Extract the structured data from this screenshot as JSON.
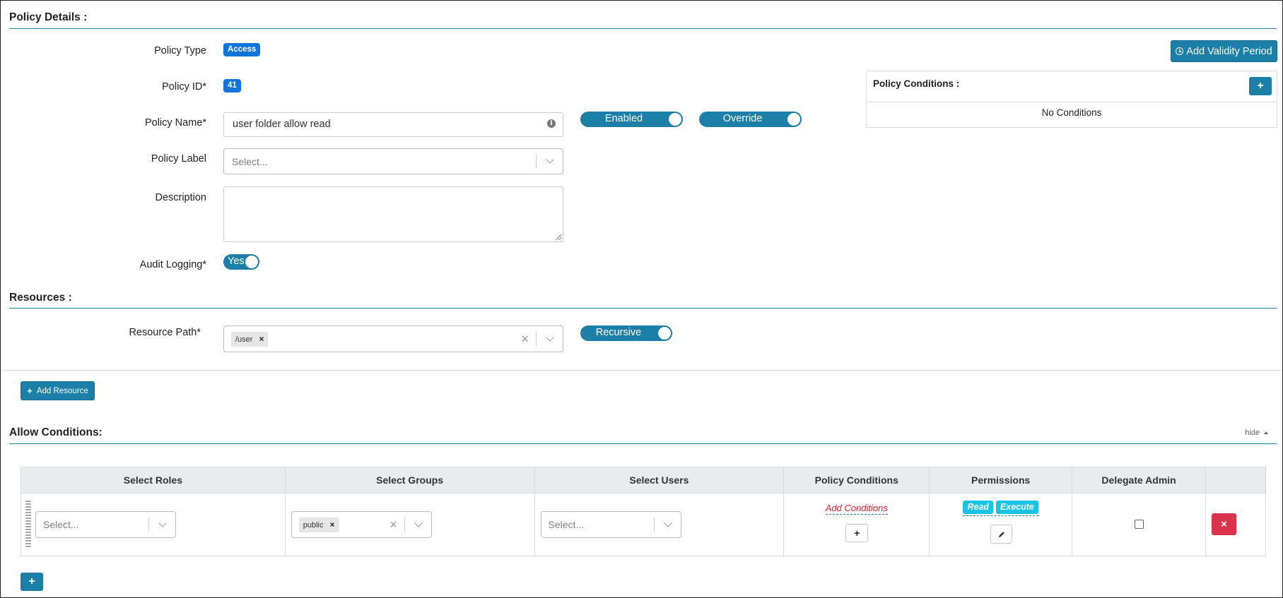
{
  "policy_details": {
    "title": "Policy Details :",
    "policy_type_label": "Policy Type",
    "policy_type_value": "Access",
    "policy_id_label": "Policy ID*",
    "policy_id_value": "41",
    "policy_name_label": "Policy Name*",
    "policy_name_value": "user folder allow read",
    "policy_label_label": "Policy Label",
    "policy_label_placeholder": "Select...",
    "description_label": "Description",
    "description_value": "",
    "audit_logging_label": "Audit Logging*",
    "audit_logging_toggle": "Yes",
    "enabled_toggle": "Enabled",
    "override_toggle": "Override",
    "add_validity_label": "Add Validity Period"
  },
  "policy_conditions_panel": {
    "title": "Policy Conditions :",
    "add_label": "+",
    "empty_text": "No Conditions"
  },
  "resources": {
    "title": "Resources :",
    "resource_path_label": "Resource Path*",
    "resource_path_values": [
      "/user"
    ],
    "recursive_toggle": "Recursive",
    "add_resource_label": "Add Resource"
  },
  "allow_conditions": {
    "title": "Allow Conditions:",
    "hide_label": "hide",
    "columns": [
      "Select Roles",
      "Select Groups",
      "Select Users",
      "Policy Conditions",
      "Permissions",
      "Delegate Admin",
      ""
    ],
    "rows": [
      {
        "roles_placeholder": "Select...",
        "groups": [
          "public"
        ],
        "users_placeholder": "Select...",
        "conditions_link": "Add Conditions",
        "permissions": [
          "Read",
          "Execute"
        ],
        "delegate_admin": false
      }
    ],
    "add_row_label": "+"
  },
  "colors": {
    "primary": "#1b7fa7",
    "badge": "#1174d9",
    "danger": "#d9344b",
    "permission_tag": "#19c3e6",
    "add_conditions_link": "#e0202e"
  },
  "icons": {
    "info": "info-circle-icon",
    "clock": "clock-icon",
    "plus": "plus-icon",
    "pencil": "pencil-icon",
    "times": "times-icon",
    "chevron_down": "chevron-down-icon",
    "caret_up": "caret-up-icon"
  }
}
